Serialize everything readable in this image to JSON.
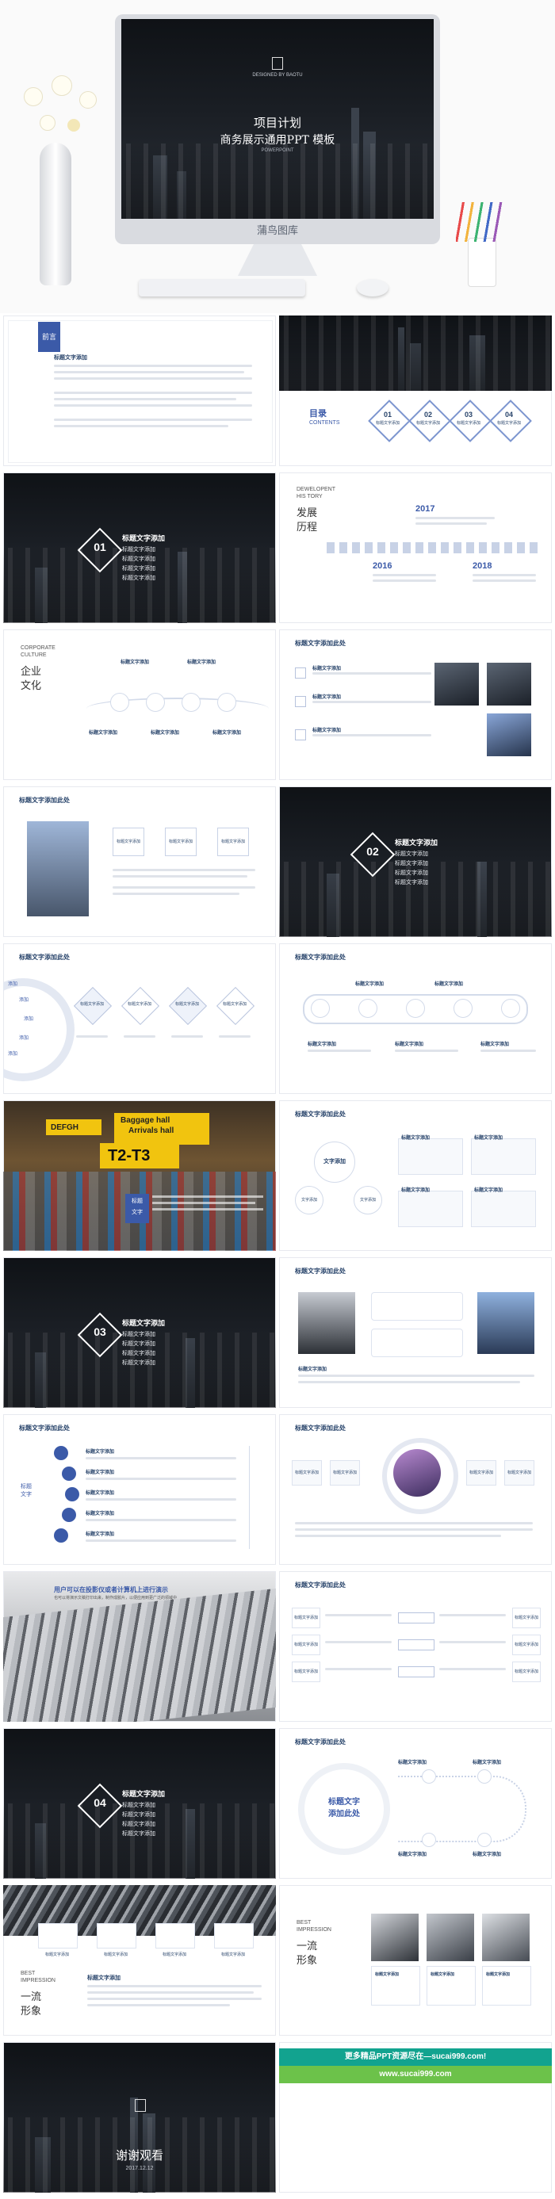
{
  "hero": {
    "designed_by": "DESIGNED BY BAOTU",
    "title_line1": "项目计划",
    "title_line2": "商务展示通用PPT 模板",
    "sub": "POWERPOINT",
    "brand": "蒲鸟图库"
  },
  "s_preface": {
    "tag": "前言",
    "heading": "标题文字添加"
  },
  "s_contents": {
    "label": "目录",
    "label_en": "CONTENTS",
    "items": [
      {
        "num": "01",
        "text": "标题文字添加"
      },
      {
        "num": "02",
        "text": "标题文字添加"
      },
      {
        "num": "03",
        "text": "标题文字添加"
      },
      {
        "num": "04",
        "text": "标题文字添加"
      }
    ]
  },
  "s_section01": {
    "num": "01",
    "title": "标题文字添加",
    "bullets": [
      "标题文字添加",
      "标题文字添加",
      "标题文字添加",
      "标题文字添加"
    ]
  },
  "s_history": {
    "en1": "DEWELOPENT",
    "en2": "HIS TORY",
    "cn1": "发展",
    "cn2": "历程",
    "years": [
      "2017",
      "2016",
      "2018"
    ]
  },
  "s_culture": {
    "en1": "CORPORATE",
    "en2": "CULTURE",
    "cn1": "企业",
    "cn2": "文化",
    "items": [
      "标题文字添加",
      "标题文字添加",
      "标题文字添加",
      "标题文字添加",
      "标题文字添加"
    ]
  },
  "s_list3": {
    "header": "标题文字添加此处",
    "items": [
      "标题文字添加",
      "标题文字添加",
      "标题文字添加"
    ]
  },
  "s_photo_left": {
    "header": "标题文字添加此处",
    "items": [
      "标题文字添加",
      "标题文字添加",
      "标题文字添加"
    ]
  },
  "s_section02": {
    "num": "02",
    "title": "标题文字添加",
    "bullets": [
      "标题文字添加",
      "标题文字添加",
      "标题文字添加",
      "标题文字添加"
    ]
  },
  "s_wheel": {
    "header": "标题文字添加此处",
    "items": [
      "标题文字添加",
      "标题文字添加",
      "标题文字添加",
      "标题文字添加"
    ],
    "left": [
      "添加",
      "添加",
      "添加",
      "添加",
      "添加"
    ]
  },
  "s_wave": {
    "header": "标题文字添加此处",
    "items": [
      "标题文字添加",
      "标题文字添加",
      "标题文字添加",
      "标题文字添加",
      "标题文字添加"
    ]
  },
  "s_airport": {
    "sign1": "DEFGH",
    "sign2": "Baggage hall",
    "sign3": "Arrivals hall",
    "sign4": "T2-T3",
    "tag1": "标题",
    "tag2": "文字"
  },
  "s_bubbles": {
    "header": "标题文字添加此处",
    "big": "文字添加",
    "small": "文字添加",
    "small2": "文字添加",
    "items": [
      "标题文字添加",
      "标题文字添加",
      "标题文字添加",
      "标题文字添加"
    ]
  },
  "s_section03": {
    "num": "03",
    "title": "标题文字添加",
    "bullets": [
      "标题文字添加",
      "标题文字添加",
      "标题文字添加",
      "标题文字添加"
    ]
  },
  "s_speech": {
    "header": "标题文字添加此处",
    "caption": "标题文字添加"
  },
  "s_tree": {
    "header": "标题文字添加此处",
    "items": [
      "标题文字添加",
      "标题文字添加",
      "标题文字添加",
      "标题文字添加",
      "标题文字添加"
    ],
    "side": [
      "标题",
      "文字"
    ]
  },
  "s_orbit": {
    "header": "标题文字添加此处",
    "items": [
      "标题文字添加",
      "标题文字添加",
      "标题文字添加",
      "标题文字添加"
    ]
  },
  "s_building": {
    "title": "用户可以在投影仪或者计算机上进行演示",
    "sub": "也可以将演示文稿打印出来，制作成胶片，以便应用到更广泛的领域中"
  },
  "s_arrows": {
    "header": "标题文字添加此处",
    "items": [
      "标题文字添加",
      "标题文字添加",
      "标题文字添加",
      "标题文字添加",
      "标题文字添加",
      "标题文字添加"
    ]
  },
  "s_section04": {
    "num": "04",
    "title": "标题文字添加",
    "bullets": [
      "标题文字添加",
      "标题文字添加",
      "标题文字添加",
      "标题文字添加"
    ]
  },
  "s_circle_flow": {
    "header": "标题文字添加此处",
    "center1": "标题文字",
    "center2": "添加此处",
    "items": [
      "标题文字添加",
      "标题文字添加",
      "标题文字添加",
      "标题文字添加"
    ]
  },
  "s_impression1": {
    "en1": "BEST",
    "en2": "IMPRESSION",
    "cn1": "一流",
    "cn2": "形象",
    "heading": "标题文字添加",
    "items": [
      "标题文字添加",
      "标题文字添加",
      "标题文字添加",
      "标题文字添加"
    ]
  },
  "s_impression2": {
    "en1": "BEST",
    "en2": "IMPRESSION",
    "cn1": "一流",
    "cn2": "形象",
    "items": [
      "标题文字添加",
      "标题文字添加",
      "标题文字添加"
    ]
  },
  "s_thanks": {
    "title": "谢谢观看",
    "date": "2017.12.12"
  },
  "s_ad": {
    "line1": "更多精品PPT资源尽在—sucai999.com!",
    "line2": "www.sucai999.com"
  },
  "colors": {
    "accent": "#3b5aa8",
    "dark": "#1a1e24",
    "green": "#3cba6b"
  }
}
